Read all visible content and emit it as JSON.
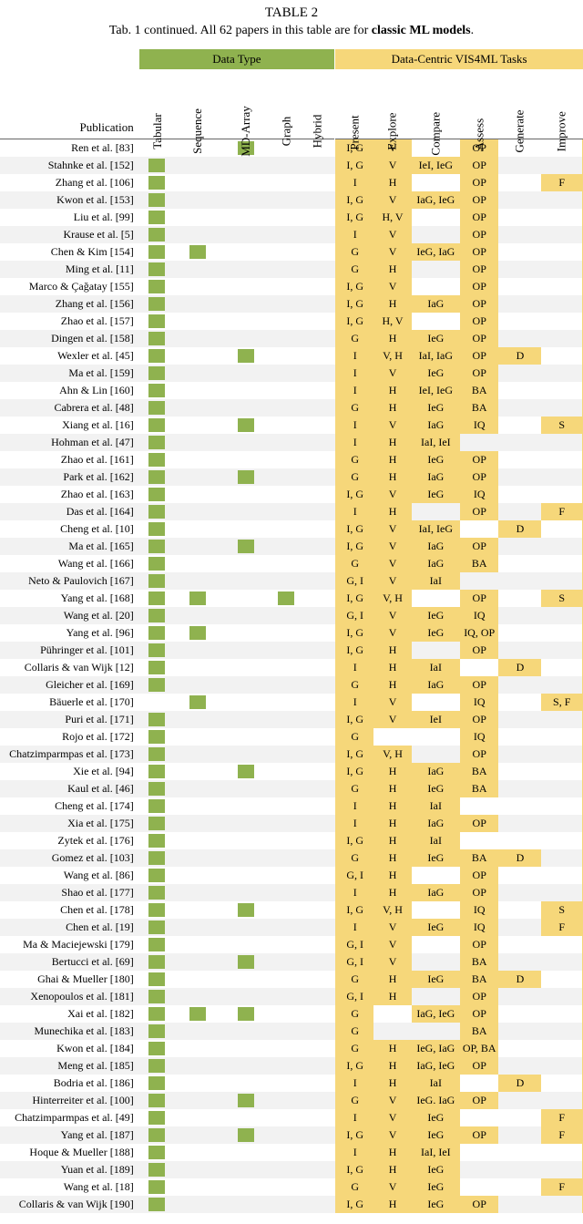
{
  "caption": {
    "table_label": "TABLE 2",
    "line": "Tab. 1 continued. All 62 papers in this table are for ",
    "bold": "classic ML models",
    "tail": "."
  },
  "group_headers": {
    "data": "Data Type",
    "tasks": "Data-Centric VIS4ML Tasks"
  },
  "pub_header": "Publication",
  "data_type_cols": [
    "Tabular",
    "Sequence",
    "MD-Array",
    "Graph",
    "Hybrid"
  ],
  "task_cols": [
    "Present",
    "Explore",
    "Compare",
    "Assess",
    "Generate",
    "Improve"
  ],
  "rows": [
    {
      "pub": "Ren et al. [83]",
      "dt": [
        0,
        0,
        1,
        0,
        0
      ],
      "tk": [
        "I, G",
        "V",
        "",
        "OP",
        "",
        ""
      ]
    },
    {
      "pub": "Stahnke et al. [152]",
      "dt": [
        1,
        0,
        0,
        0,
        0
      ],
      "tk": [
        "I, G",
        "V",
        "IeI, IeG",
        "OP",
        "",
        ""
      ]
    },
    {
      "pub": "Zhang et al. [106]",
      "dt": [
        1,
        0,
        0,
        0,
        0
      ],
      "tk": [
        "I",
        "H",
        "",
        "OP",
        "",
        "F"
      ]
    },
    {
      "pub": "Kwon et al. [153]",
      "dt": [
        1,
        0,
        0,
        0,
        0
      ],
      "tk": [
        "I, G",
        "V",
        "IaG, IeG",
        "OP",
        "",
        ""
      ]
    },
    {
      "pub": "Liu et al. [99]",
      "dt": [
        1,
        0,
        0,
        0,
        0
      ],
      "tk": [
        "I, G",
        "H, V",
        "",
        "OP",
        "",
        ""
      ]
    },
    {
      "pub": "Krause et al. [5]",
      "dt": [
        1,
        0,
        0,
        0,
        0
      ],
      "tk": [
        "I",
        "V",
        "",
        "OP",
        "",
        ""
      ]
    },
    {
      "pub": "Chen & Kim [154]",
      "dt": [
        1,
        1,
        0,
        0,
        0
      ],
      "tk": [
        "G",
        "V",
        "IeG, IaG",
        "OP",
        "",
        ""
      ]
    },
    {
      "pub": "Ming et al. [11]",
      "dt": [
        1,
        0,
        0,
        0,
        0
      ],
      "tk": [
        "G",
        "H",
        "",
        "OP",
        "",
        ""
      ]
    },
    {
      "pub": "Marco & Çağatay [155]",
      "dt": [
        1,
        0,
        0,
        0,
        0
      ],
      "tk": [
        "I, G",
        "V",
        "",
        "OP",
        "",
        ""
      ]
    },
    {
      "pub": "Zhang et al. [156]",
      "dt": [
        1,
        0,
        0,
        0,
        0
      ],
      "tk": [
        "I, G",
        "H",
        "IaG",
        "OP",
        "",
        ""
      ]
    },
    {
      "pub": "Zhao et al. [157]",
      "dt": [
        1,
        0,
        0,
        0,
        0
      ],
      "tk": [
        "I, G",
        "H, V",
        "",
        "OP",
        "",
        ""
      ]
    },
    {
      "pub": "Dingen et al. [158]",
      "dt": [
        1,
        0,
        0,
        0,
        0
      ],
      "tk": [
        "G",
        "H",
        "IeG",
        "OP",
        "",
        ""
      ]
    },
    {
      "pub": "Wexler et al. [45]",
      "dt": [
        1,
        0,
        1,
        0,
        0
      ],
      "tk": [
        "I",
        "V, H",
        "IaI, IaG",
        "OP",
        "D",
        ""
      ]
    },
    {
      "pub": "Ma et al. [159]",
      "dt": [
        1,
        0,
        0,
        0,
        0
      ],
      "tk": [
        "I",
        "V",
        "IeG",
        "OP",
        "",
        ""
      ]
    },
    {
      "pub": "Ahn & Lin [160]",
      "dt": [
        1,
        0,
        0,
        0,
        0
      ],
      "tk": [
        "I",
        "H",
        "IeI, IeG",
        "BA",
        "",
        ""
      ]
    },
    {
      "pub": "Cabrera et al. [48]",
      "dt": [
        1,
        0,
        0,
        0,
        0
      ],
      "tk": [
        "G",
        "H",
        "IeG",
        "BA",
        "",
        ""
      ]
    },
    {
      "pub": "Xiang et al. [16]",
      "dt": [
        1,
        0,
        1,
        0,
        0
      ],
      "tk": [
        "I",
        "V",
        "IaG",
        "IQ",
        "",
        "S"
      ]
    },
    {
      "pub": "Hohman et al. [47]",
      "dt": [
        1,
        0,
        0,
        0,
        0
      ],
      "tk": [
        "I",
        "H",
        "IaI, IeI",
        "",
        "",
        ""
      ]
    },
    {
      "pub": "Zhao et al. [161]",
      "dt": [
        1,
        0,
        0,
        0,
        0
      ],
      "tk": [
        "G",
        "H",
        "IeG",
        "OP",
        "",
        ""
      ]
    },
    {
      "pub": "Park et al. [162]",
      "dt": [
        1,
        0,
        1,
        0,
        0
      ],
      "tk": [
        "G",
        "H",
        "IaG",
        "OP",
        "",
        ""
      ]
    },
    {
      "pub": "Zhao et al. [163]",
      "dt": [
        1,
        0,
        0,
        0,
        0
      ],
      "tk": [
        "I, G",
        "V",
        "IeG",
        "IQ",
        "",
        ""
      ]
    },
    {
      "pub": "Das et al. [164]",
      "dt": [
        1,
        0,
        0,
        0,
        0
      ],
      "tk": [
        "I",
        "H",
        "",
        "OP",
        "",
        "F"
      ]
    },
    {
      "pub": "Cheng et al. [10]",
      "dt": [
        1,
        0,
        0,
        0,
        0
      ],
      "tk": [
        "I, G",
        "V",
        "IaI, IeG",
        "",
        "D",
        ""
      ]
    },
    {
      "pub": "Ma et al. [165]",
      "dt": [
        1,
        0,
        1,
        0,
        0
      ],
      "tk": [
        "I, G",
        "V",
        "IaG",
        "OP",
        "",
        ""
      ]
    },
    {
      "pub": "Wang et al. [166]",
      "dt": [
        1,
        0,
        0,
        0,
        0
      ],
      "tk": [
        "G",
        "V",
        "IaG",
        "BA",
        "",
        ""
      ]
    },
    {
      "pub": "Neto & Paulovich [167]",
      "dt": [
        1,
        0,
        0,
        0,
        0
      ],
      "tk": [
        "G, I",
        "V",
        "IaI",
        "",
        "",
        ""
      ]
    },
    {
      "pub": "Yang et al. [168]",
      "dt": [
        1,
        1,
        0,
        1,
        0
      ],
      "tk": [
        "I, G",
        "V, H",
        "",
        "OP",
        "",
        "S"
      ]
    },
    {
      "pub": "Wang et al. [20]",
      "dt": [
        1,
        0,
        0,
        0,
        0
      ],
      "tk": [
        "G, I",
        "V",
        "IeG",
        "IQ",
        "",
        ""
      ]
    },
    {
      "pub": "Yang et al. [96]",
      "dt": [
        1,
        1,
        0,
        0,
        0
      ],
      "tk": [
        "I, G",
        "V",
        "IeG",
        "IQ, OP",
        "",
        ""
      ]
    },
    {
      "pub": "Pühringer et al. [101]",
      "dt": [
        1,
        0,
        0,
        0,
        0
      ],
      "tk": [
        "I, G",
        "H",
        "",
        "OP",
        "",
        ""
      ]
    },
    {
      "pub": "Collaris & van Wijk [12]",
      "dt": [
        1,
        0,
        0,
        0,
        0
      ],
      "tk": [
        "I",
        "H",
        "IaI",
        "",
        "D",
        ""
      ]
    },
    {
      "pub": "Gleicher et al. [169]",
      "dt": [
        1,
        0,
        0,
        0,
        0
      ],
      "tk": [
        "G",
        "H",
        "IaG",
        "OP",
        "",
        ""
      ]
    },
    {
      "pub": "Bäuerle et al. [170]",
      "dt": [
        0,
        1,
        0,
        0,
        0
      ],
      "tk": [
        "I",
        "V",
        "",
        "IQ",
        "",
        "S, F"
      ]
    },
    {
      "pub": "Puri et al. [171]",
      "dt": [
        1,
        0,
        0,
        0,
        0
      ],
      "tk": [
        "I, G",
        "V",
        "IeI",
        "OP",
        "",
        ""
      ]
    },
    {
      "pub": "Rojo et al. [172]",
      "dt": [
        1,
        0,
        0,
        0,
        0
      ],
      "tk": [
        "G",
        "",
        "",
        "IQ",
        "",
        ""
      ]
    },
    {
      "pub": "Chatzimparmpas et al. [173]",
      "dt": [
        1,
        0,
        0,
        0,
        0
      ],
      "tk": [
        "I, G",
        "V, H",
        "",
        "OP",
        "",
        ""
      ]
    },
    {
      "pub": "Xie et al. [94]",
      "dt": [
        1,
        0,
        1,
        0,
        0
      ],
      "tk": [
        "I, G",
        "H",
        "IaG",
        "BA",
        "",
        ""
      ]
    },
    {
      "pub": "Kaul et al. [46]",
      "dt": [
        1,
        0,
        0,
        0,
        0
      ],
      "tk": [
        "G",
        "H",
        "IeG",
        "BA",
        "",
        ""
      ]
    },
    {
      "pub": "Cheng et al. [174]",
      "dt": [
        1,
        0,
        0,
        0,
        0
      ],
      "tk": [
        "I",
        "H",
        "IaI",
        "",
        "",
        ""
      ]
    },
    {
      "pub": "Xia et al. [175]",
      "dt": [
        1,
        0,
        0,
        0,
        0
      ],
      "tk": [
        "I",
        "H",
        "IaG",
        "OP",
        "",
        ""
      ]
    },
    {
      "pub": "Zytek et al. [176]",
      "dt": [
        1,
        0,
        0,
        0,
        0
      ],
      "tk": [
        "I, G",
        "H",
        "IaI",
        "",
        "",
        ""
      ]
    },
    {
      "pub": "Gomez et al. [103]",
      "dt": [
        1,
        0,
        0,
        0,
        0
      ],
      "tk": [
        "G",
        "H",
        "IeG",
        "BA",
        "D",
        ""
      ]
    },
    {
      "pub": "Wang et al. [86]",
      "dt": [
        1,
        0,
        0,
        0,
        0
      ],
      "tk": [
        "G, I",
        "H",
        "",
        "OP",
        "",
        ""
      ]
    },
    {
      "pub": "Shao et al. [177]",
      "dt": [
        1,
        0,
        0,
        0,
        0
      ],
      "tk": [
        "I",
        "H",
        "IaG",
        "OP",
        "",
        ""
      ]
    },
    {
      "pub": "Chen et al. [178]",
      "dt": [
        1,
        0,
        1,
        0,
        0
      ],
      "tk": [
        "I, G",
        "V, H",
        "",
        "IQ",
        "",
        "S"
      ]
    },
    {
      "pub": "Chen et al. [19]",
      "dt": [
        1,
        0,
        0,
        0,
        0
      ],
      "tk": [
        "I",
        "V",
        "IeG",
        "IQ",
        "",
        "F"
      ]
    },
    {
      "pub": "Ma & Maciejewski [179]",
      "dt": [
        1,
        0,
        0,
        0,
        0
      ],
      "tk": [
        "G, I",
        "V",
        "",
        "OP",
        "",
        ""
      ]
    },
    {
      "pub": "Bertucci et al. [69]",
      "dt": [
        1,
        0,
        1,
        0,
        0
      ],
      "tk": [
        "G, I",
        "V",
        "",
        "BA",
        "",
        ""
      ]
    },
    {
      "pub": "Ghai & Mueller [180]",
      "dt": [
        1,
        0,
        0,
        0,
        0
      ],
      "tk": [
        "G",
        "H",
        "IeG",
        "BA",
        "D",
        ""
      ]
    },
    {
      "pub": "Xenopoulos et al. [181]",
      "dt": [
        1,
        0,
        0,
        0,
        0
      ],
      "tk": [
        "G, I",
        "H",
        "",
        "OP",
        "",
        ""
      ]
    },
    {
      "pub": "Xai et al. [182]",
      "dt": [
        1,
        1,
        1,
        0,
        0
      ],
      "tk": [
        "G",
        "",
        "IaG, IeG",
        "OP",
        "",
        ""
      ]
    },
    {
      "pub": "Munechika et al. [183]",
      "dt": [
        1,
        0,
        0,
        0,
        0
      ],
      "tk": [
        "G",
        "",
        "",
        "BA",
        "",
        ""
      ]
    },
    {
      "pub": "Kwon et al. [184]",
      "dt": [
        1,
        0,
        0,
        0,
        0
      ],
      "tk": [
        "G",
        "H",
        "IeG, IaG",
        "OP, BA",
        "",
        ""
      ]
    },
    {
      "pub": "Meng et al. [185]",
      "dt": [
        1,
        0,
        0,
        0,
        0
      ],
      "tk": [
        "I, G",
        "H",
        "IaG, IeG",
        "OP",
        "",
        ""
      ]
    },
    {
      "pub": "Bodria et al. [186]",
      "dt": [
        1,
        0,
        0,
        0,
        0
      ],
      "tk": [
        "I",
        "H",
        "IaI",
        "",
        "D",
        ""
      ]
    },
    {
      "pub": "Hinterreiter et al. [100]",
      "dt": [
        1,
        0,
        1,
        0,
        0
      ],
      "tk": [
        "G",
        "V",
        "IeG. IaG",
        "OP",
        "",
        ""
      ]
    },
    {
      "pub": "Chatzimparmpas et al. [49]",
      "dt": [
        1,
        0,
        0,
        0,
        0
      ],
      "tk": [
        "I",
        "V",
        "IeG",
        "",
        "",
        "F"
      ]
    },
    {
      "pub": "Yang et al. [187]",
      "dt": [
        1,
        0,
        1,
        0,
        0
      ],
      "tk": [
        "I, G",
        "V",
        "IeG",
        "OP",
        "",
        "F"
      ]
    },
    {
      "pub": "Hoque & Mueller [188]",
      "dt": [
        1,
        0,
        0,
        0,
        0
      ],
      "tk": [
        "I",
        "H",
        "IaI, IeI",
        "",
        "",
        ""
      ]
    },
    {
      "pub": "Yuan et al. [189]",
      "dt": [
        1,
        0,
        0,
        0,
        0
      ],
      "tk": [
        "I, G",
        "H",
        "IeG",
        "",
        "",
        ""
      ]
    },
    {
      "pub": "Wang et al. [18]",
      "dt": [
        1,
        0,
        0,
        0,
        0
      ],
      "tk": [
        "G",
        "V",
        "IeG",
        "",
        "",
        "F"
      ]
    },
    {
      "pub": "Collaris & van Wijk  [190]",
      "dt": [
        1,
        0,
        0,
        0,
        0
      ],
      "tk": [
        "I, G",
        "H",
        "IeG",
        "OP",
        "",
        ""
      ]
    }
  ]
}
